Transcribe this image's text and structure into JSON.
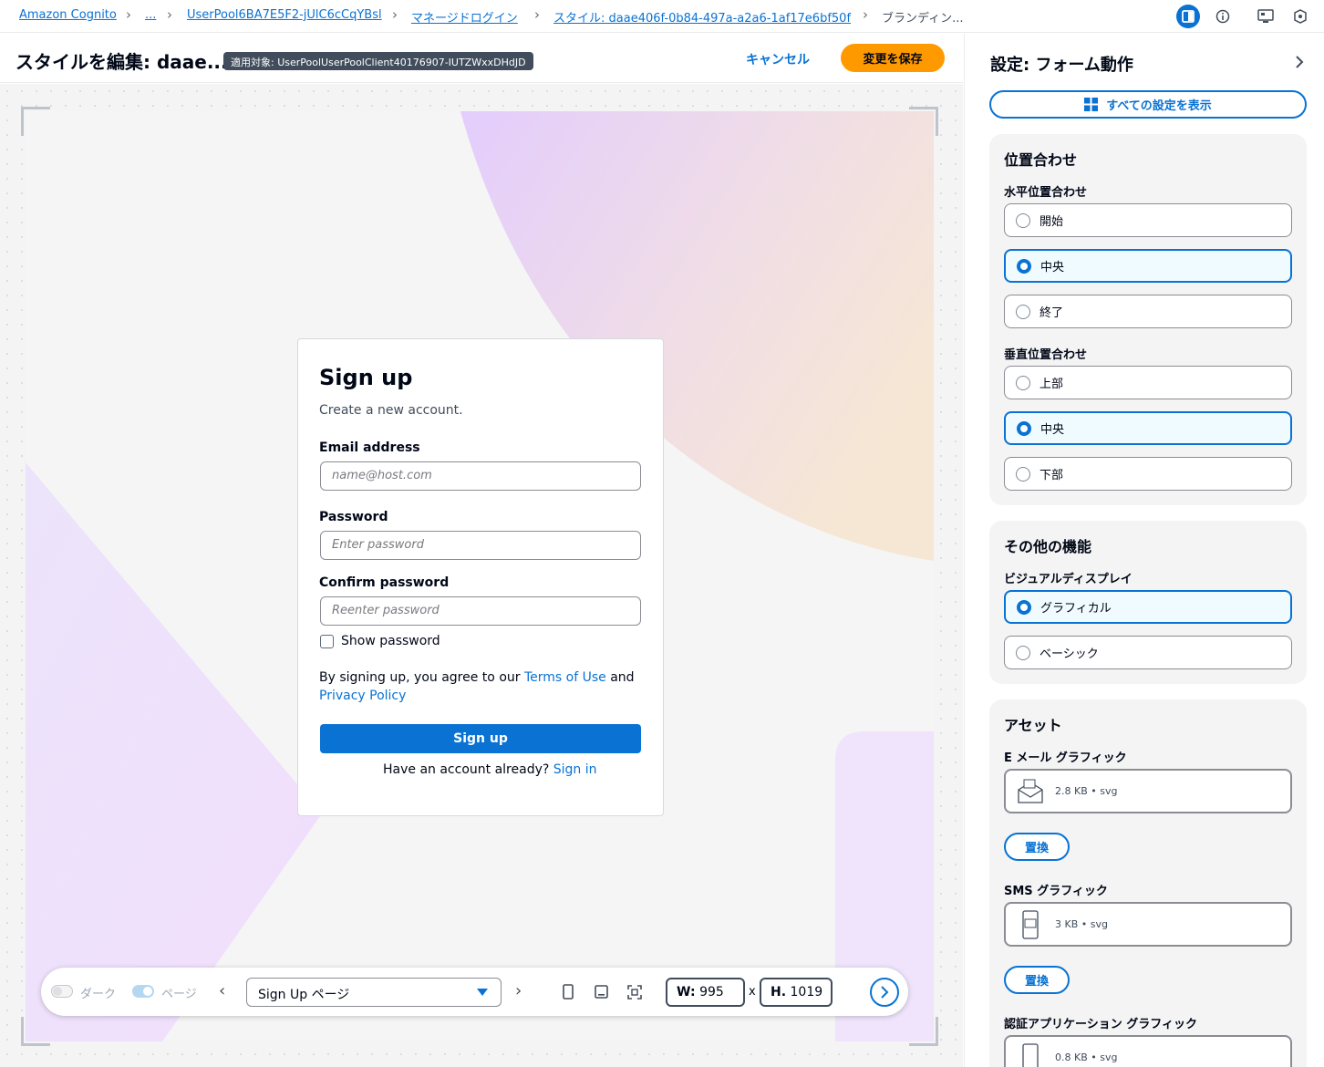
{
  "breadcrumbs": [
    "Amazon Cognito",
    "...",
    "UserPool6BA7E5F2-jUlC6cCqYBsl",
    "マネージドログイン",
    "スタイル: daae406f-0b84-497a-a2a6-1af17e6bf50f",
    "ブランディン..."
  ],
  "editor": {
    "title": "スタイルを編集: daae...",
    "badge": "適用対象: UserPoolUserPoolClient40176907-IUTZWxxDHdJD",
    "cancel": "キャンセル",
    "save": "変更を保存"
  },
  "form": {
    "title": "Sign up",
    "subtitle": "Create a new account.",
    "email_label": "Email address",
    "email_placeholder": "name@host.com",
    "password_label": "Password",
    "password_placeholder": "Enter password",
    "confirm_label": "Confirm password",
    "confirm_placeholder": "Reenter password",
    "show_password": "Show password",
    "terms_prefix": "By signing up, you agree to our",
    "terms_link": "Terms of Use",
    "terms_and": "and",
    "privacy_link": "Privacy Policy",
    "button": "Sign up",
    "have_account": "Have an account already?",
    "signin_link": "Sign in"
  },
  "toolbar": {
    "dark": "ダーク",
    "page": "ページ",
    "page_select": "Sign Up ページ",
    "w_label": "W:",
    "w_value": "995",
    "x": "x",
    "h_label": "H.",
    "h_value": "1019"
  },
  "panel": {
    "title": "設定: フォーム動作",
    "show_all": "すべての設定を表示",
    "alignment": {
      "title": "位置合わせ",
      "horizontal_label": "水平位置合わせ",
      "horizontal": [
        "開始",
        "中央",
        "終了"
      ],
      "horizontal_selected": 1,
      "vertical_label": "垂直位置合わせ",
      "vertical": [
        "上部",
        "中央",
        "下部"
      ],
      "vertical_selected": 1
    },
    "other": {
      "title": "その他の機能",
      "visual_label": "ビジュアルディスプレイ",
      "visual": [
        "グラフィカル",
        "ベーシック"
      ],
      "visual_selected": 0
    },
    "assets": {
      "title": "アセット",
      "email_label": "E メール グラフィック",
      "email_meta": "2.8 KB • svg",
      "sms_label": "SMS グラフィック",
      "sms_meta": "3 KB • svg",
      "auth_label": "認証アプリケーション グラフィック",
      "auth_meta": "0.8 KB • svg",
      "replace": "置換"
    }
  },
  "colors": {
    "accent": "#0972d3",
    "save": "#ff9900"
  }
}
